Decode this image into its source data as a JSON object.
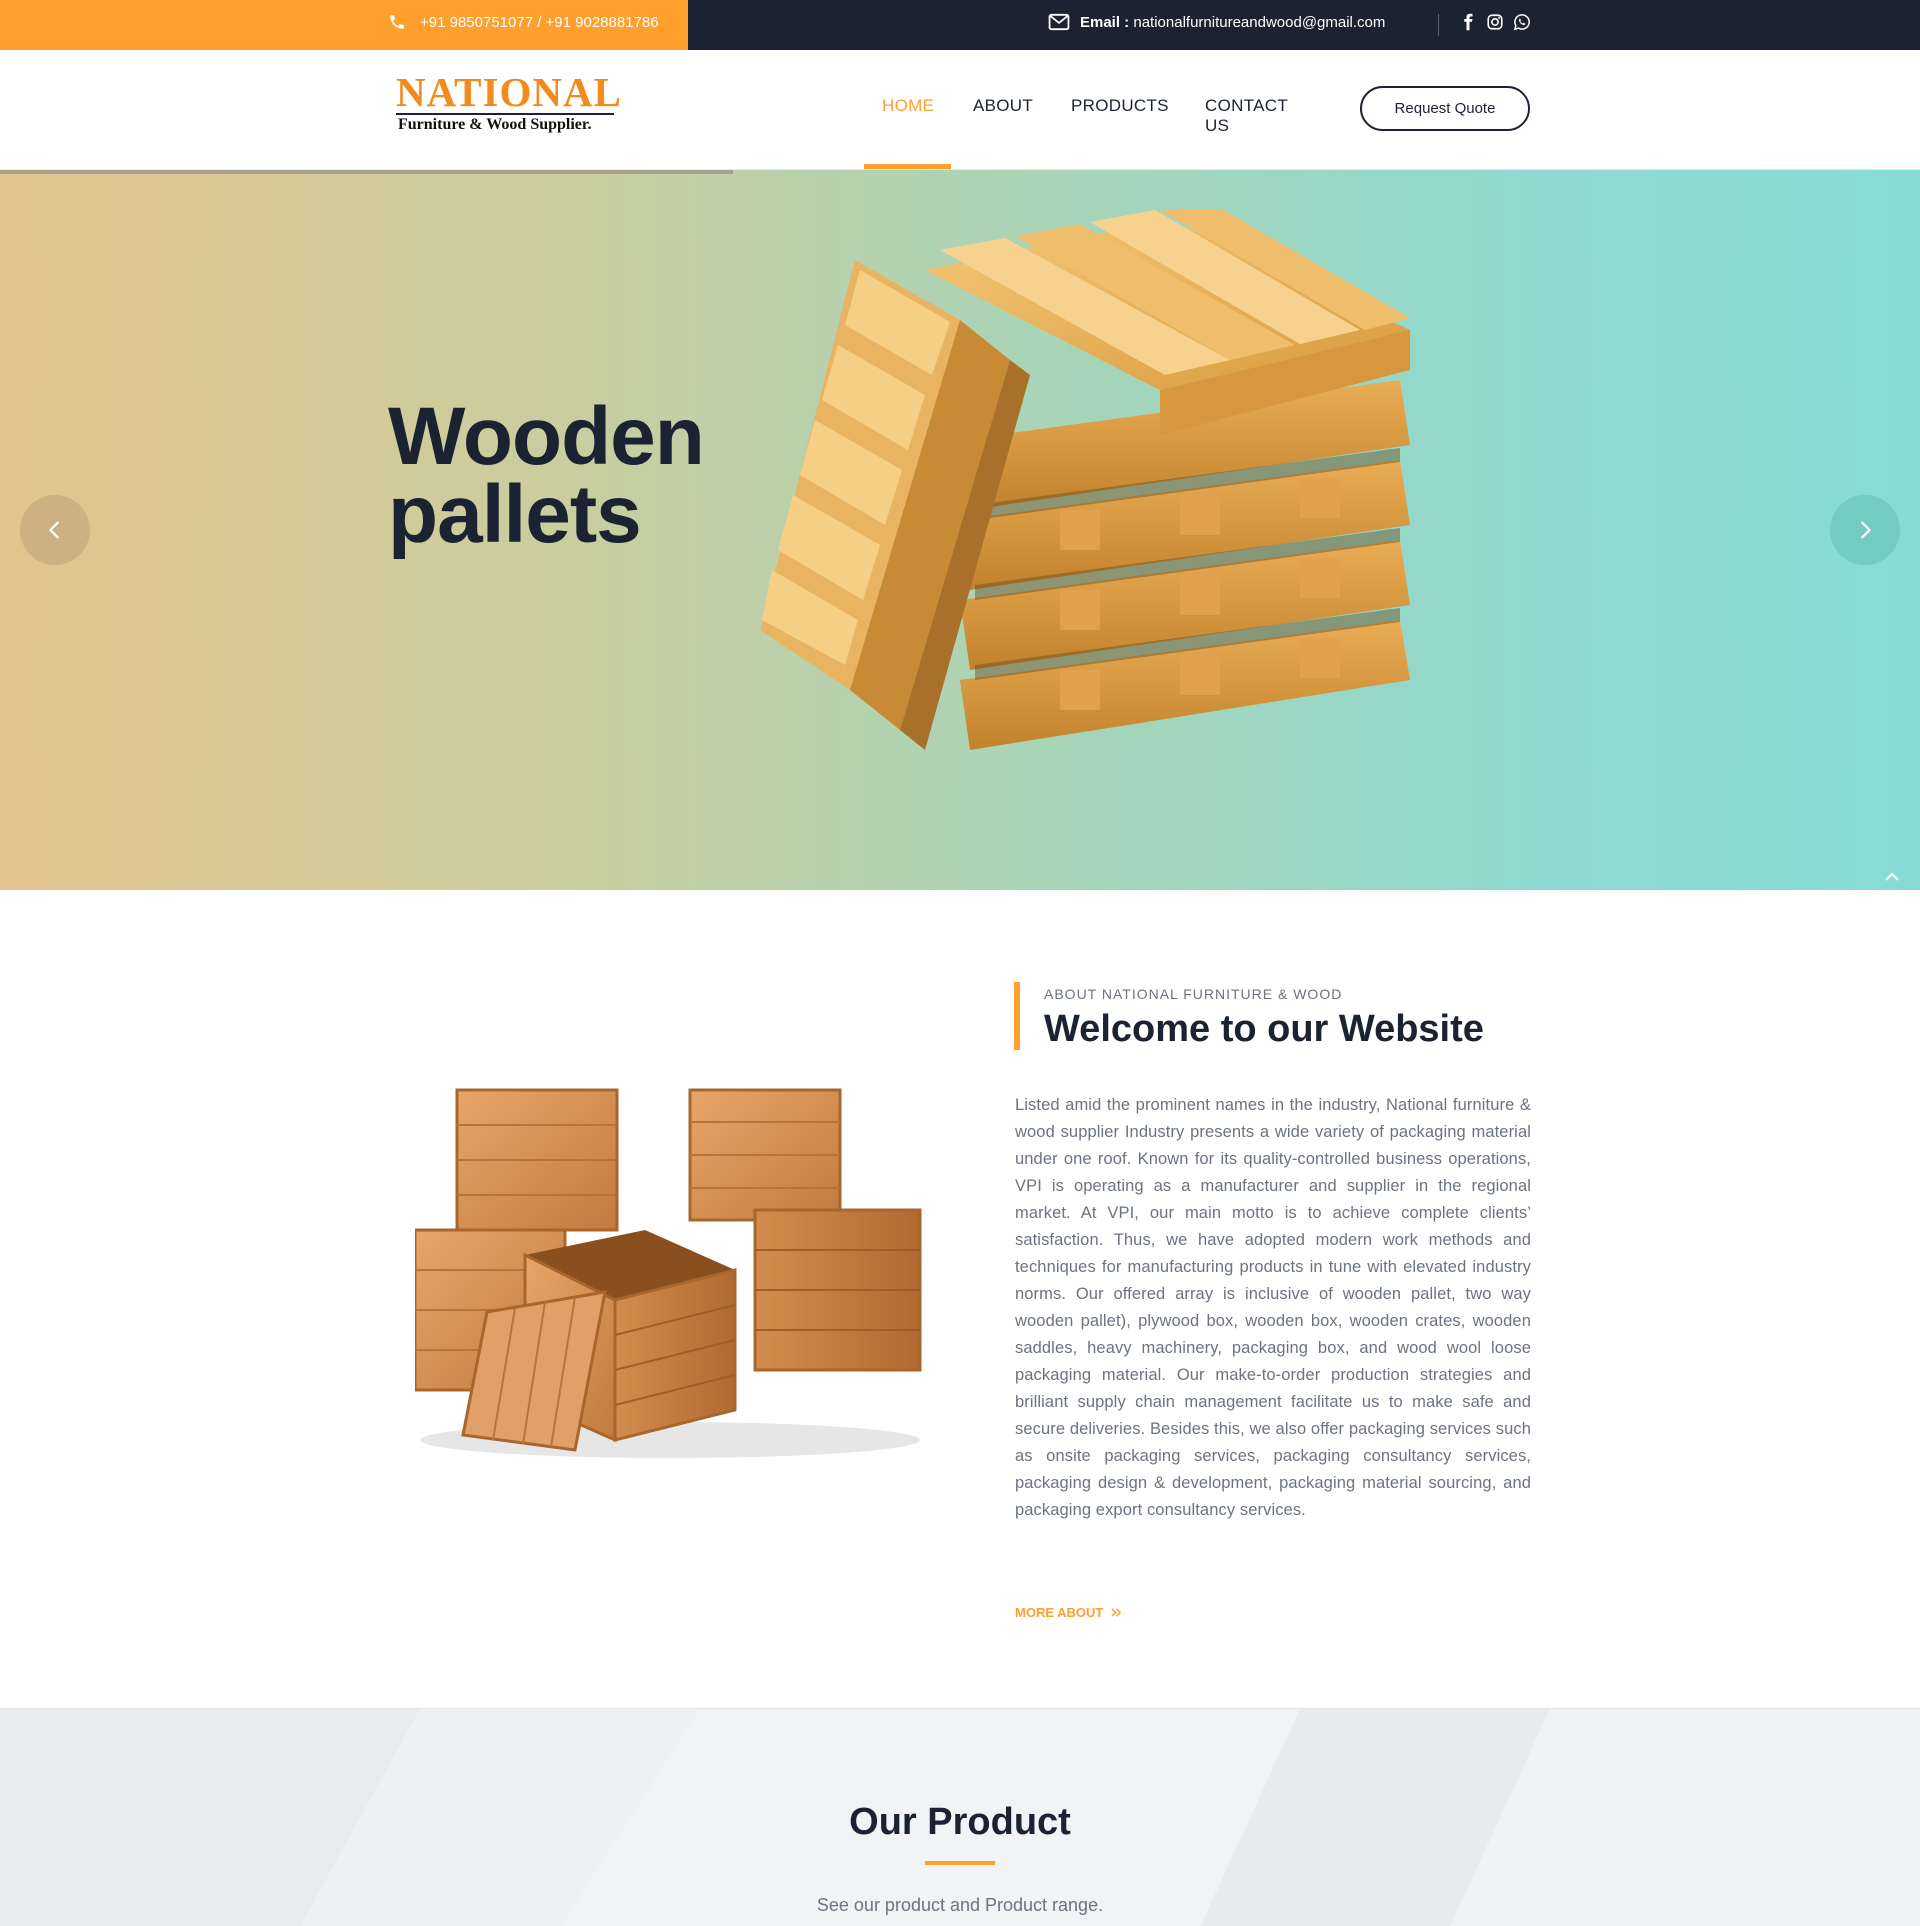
{
  "topbar": {
    "phone": "+91 9850751077 / +91 9028881786",
    "email_label": "Email :",
    "email": "nationalfurnitureandwood@gmail.com",
    "social_icons": [
      "facebook-icon",
      "instagram-icon",
      "whatsapp-icon"
    ]
  },
  "header": {
    "logo_title": "NATIONAL",
    "logo_subtitle": "Furniture & Wood Supplier.",
    "nav": [
      "HOME",
      "ABOUT",
      "PRODUCTS",
      "CONTACT US"
    ],
    "active_nav": "HOME",
    "quote_button": "Request Quote"
  },
  "hero": {
    "title_line1": "Wooden",
    "title_line2": "pallets"
  },
  "about": {
    "eyebrow": "ABOUT NATIONAL FURNITURE & WOOD",
    "heading": "Welcome to our Website",
    "body": "Listed amid the prominent names in the industry, National furniture & wood supplier Industry presents a wide variety of packaging material under one roof. Known for its quality-controlled business operations, VPI is operating as a manufacturer and supplier in the regional market. At VPI, our main motto is to achieve complete clients’ satisfaction. Thus, we have adopted modern work methods and techniques for manufacturing products in tune with elevated industry norms. Our offered array is inclusive of wooden pallet, two way wooden pallet), plywood box, wooden box, wooden crates, wooden saddles, heavy machinery, packaging box, and wood wool loose packaging material. Our make-to-order production strategies and brilliant supply chain management facilitate us to make safe and secure deliveries. Besides this, we also offer packaging services such as onsite packaging services, packaging consultancy services, packaging design & development, packaging material sourcing, and packaging export consultancy services.",
    "more_link": "MORE ABOUT"
  },
  "products": {
    "title": "Our Product",
    "subtitle": "See our product and Product range."
  },
  "colors": {
    "accent": "#ff9f2e",
    "dark": "#1b2333",
    "text_muted": "#6c7380",
    "hero_left": "#e3c48e",
    "hero_right": "#86dcd4"
  }
}
